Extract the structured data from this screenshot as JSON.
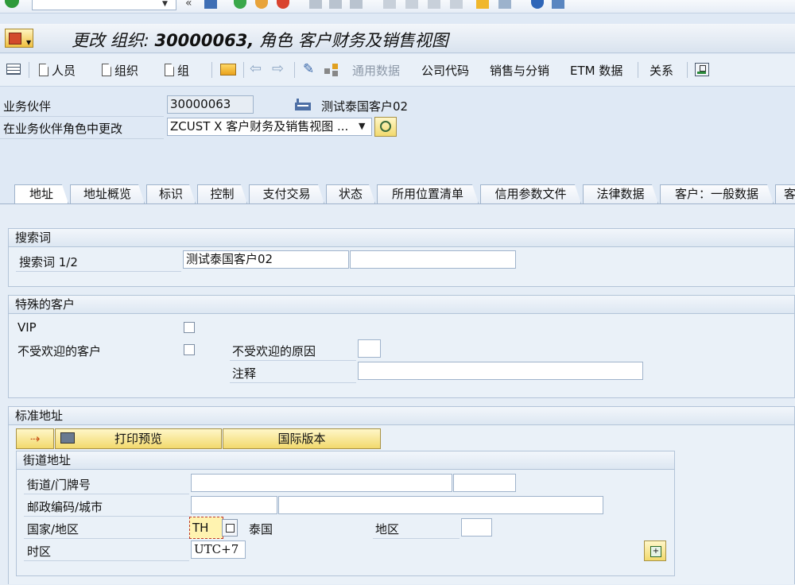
{
  "window": {
    "title_prefix": "更改 组织:",
    "title_number": "30000063,",
    "title_suffix": "角色 客户财务及销售视图"
  },
  "apptoolbar": {
    "person": "人员",
    "organization": "组织",
    "group": "组",
    "general_data": "通用数据",
    "company_code": "公司代码",
    "sales_distribution": "销售与分销",
    "etm_data": "ETM 数据",
    "relations": "关系"
  },
  "header": {
    "bp_label": "业务伙伴",
    "bp_value": "30000063",
    "bp_name": "测试泰国客户02",
    "role_label": "在业务伙伴角色中更改",
    "role_value": "ZCUST X 客户财务及销售视图 ..."
  },
  "tabs": [
    "地址",
    "地址概览",
    "标识",
    "控制",
    "支付交易",
    "状态",
    "所用位置清单",
    "信用参数文件",
    "法律数据",
    "客户：一般数据",
    "客"
  ],
  "search_group": {
    "title": "搜索词",
    "term_label": "搜索词 1/2",
    "term1": "测试泰国客户02",
    "term2": ""
  },
  "special_group": {
    "title": "特殊的客户",
    "vip_label": "VIP",
    "unwelcome_label": "不受欢迎的客户",
    "reason_label": "不受欢迎的原因",
    "reason_value": "",
    "note_label": "注释",
    "note_value": ""
  },
  "address_group": {
    "title": "标准地址",
    "print_preview": "打印预览",
    "intl_version": "国际版本",
    "street_group_title": "街道地址",
    "street_label": "街道/门牌号",
    "postcode_label": "邮政编码/城市",
    "country_label": "国家/地区",
    "country_value": "TH",
    "country_name": "泰国",
    "region_label": "地区",
    "timezone_label": "时区",
    "timezone_value": "UTC+7"
  },
  "colors": {
    "background": "#dfe9f5",
    "button_yellow": "#f2d96d",
    "focus_red": "#c0392b"
  }
}
